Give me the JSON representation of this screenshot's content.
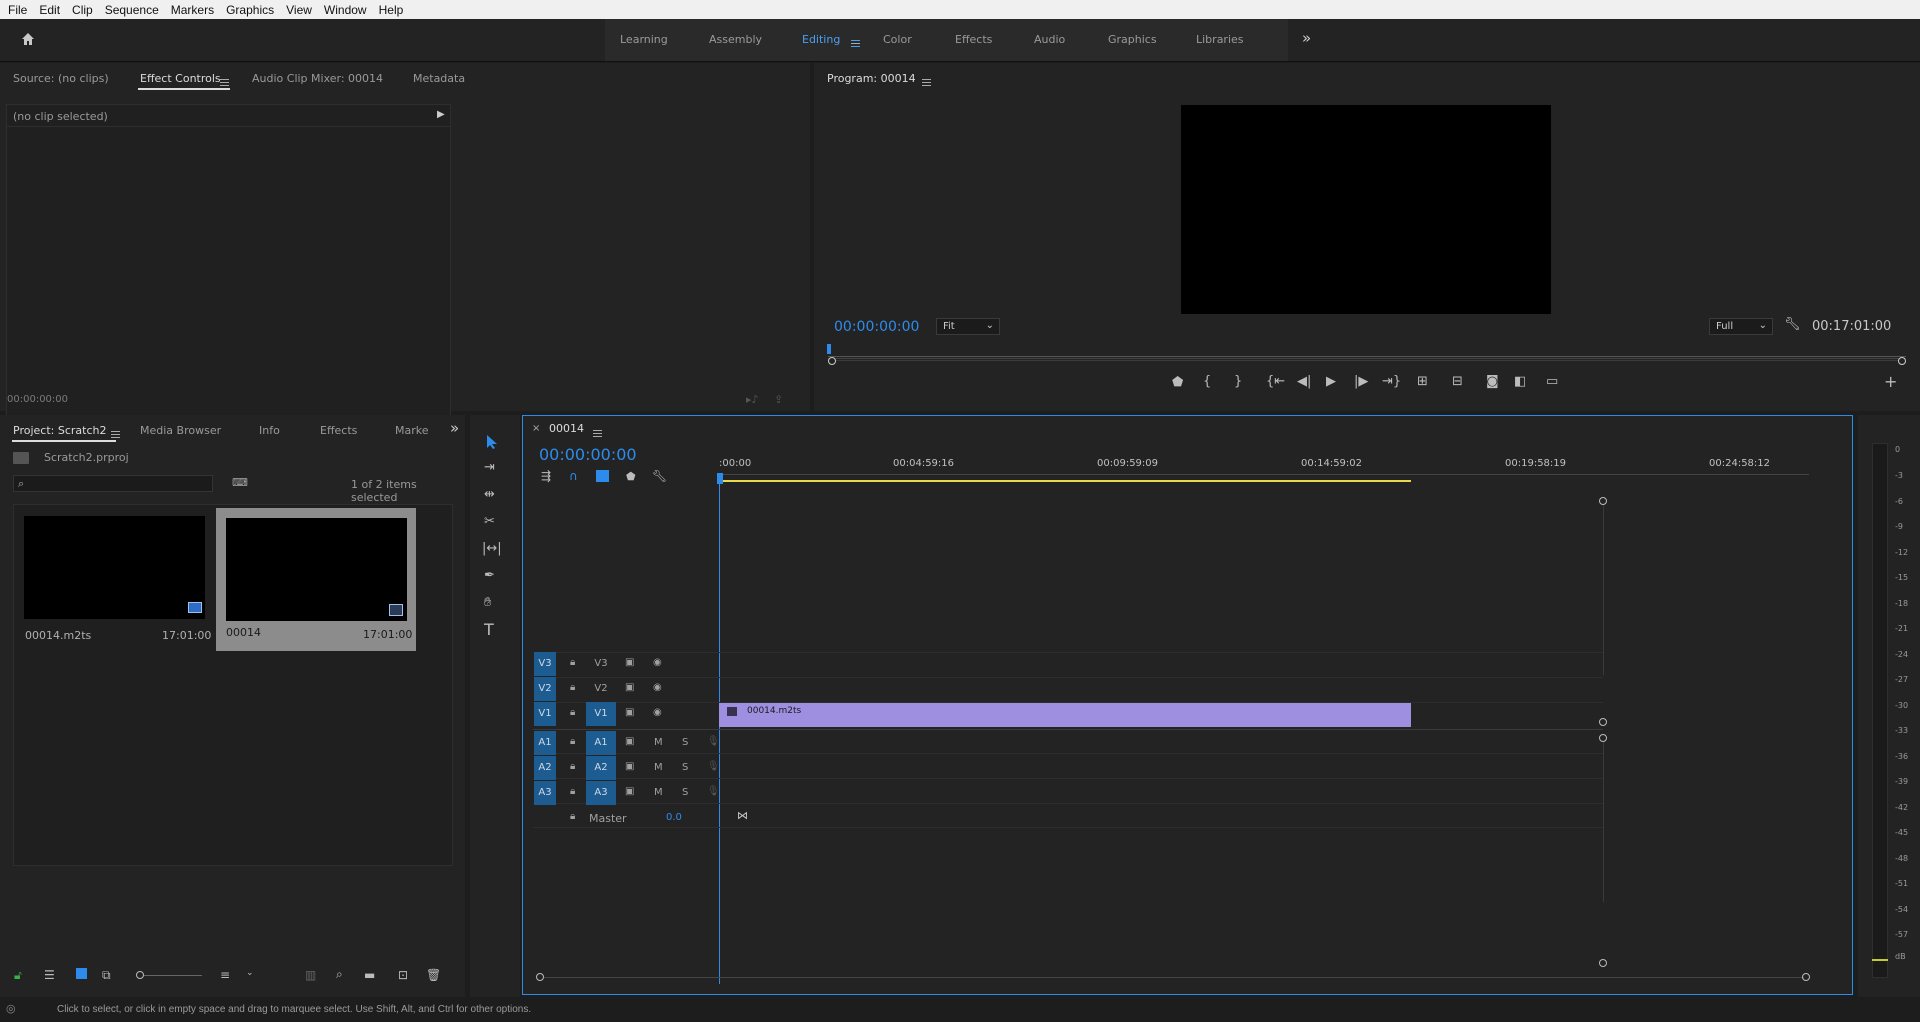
{
  "menu": [
    "File",
    "Edit",
    "Clip",
    "Sequence",
    "Markers",
    "Graphics",
    "View",
    "Window",
    "Help"
  ],
  "workspaces": {
    "tabs": [
      "Learning",
      "Assembly",
      "Editing",
      "Color",
      "Effects",
      "Audio",
      "Graphics",
      "Libraries"
    ],
    "active": "Editing",
    "more": "»"
  },
  "source_panel": {
    "tabs": [
      "Source: (no clips)",
      "Effect Controls",
      "Audio Clip Mixer: 00014",
      "Metadata"
    ],
    "active_tab": "Effect Controls",
    "no_clip": "(no clip selected)",
    "timecode": "00:00:00:00"
  },
  "program_panel": {
    "title": "Program: 00014",
    "timecode": "00:00:00:00",
    "fit": "Fit",
    "quality": "Full",
    "duration": "00:17:01:00"
  },
  "project_panel": {
    "tabs": [
      "Project: Scratch2",
      "Media Browser",
      "Info",
      "Effects",
      "Marke"
    ],
    "active_tab": "Project: Scratch2",
    "project_file": "Scratch2.prproj",
    "selection_info": "1 of 2 items selected",
    "search_placeholder": "",
    "items": [
      {
        "name": "00014.m2ts",
        "duration": "17:01:00",
        "selected": false
      },
      {
        "name": "00014",
        "duration": "17:01:00",
        "selected": true
      }
    ]
  },
  "timeline": {
    "sequence_name": "00014",
    "timecode": "00:00:00:00",
    "ruler": [
      ":00:00",
      "00:04:59:16",
      "00:09:59:09",
      "00:14:59:02",
      "00:19:58:19",
      "00:24:58:12"
    ],
    "video_tracks": [
      {
        "id": "V3",
        "target": "V3"
      },
      {
        "id": "V2",
        "target": "V2"
      },
      {
        "id": "V1",
        "target": "V1"
      }
    ],
    "audio_tracks": [
      {
        "id": "A1",
        "target": "A1",
        "m": "M",
        "s": "S"
      },
      {
        "id": "A2",
        "target": "A2",
        "m": "M",
        "s": "S"
      },
      {
        "id": "A3",
        "target": "A3",
        "m": "M",
        "s": "S"
      }
    ],
    "master": {
      "label": "Master",
      "value": "0.0"
    },
    "clip": {
      "name": "00014.m2ts",
      "color": "#9f8fe0"
    }
  },
  "meter_scale": [
    "0",
    "-3",
    "-6",
    "-9",
    "-12",
    "-15",
    "-18",
    "-21",
    "-24",
    "-27",
    "-30",
    "-33",
    "-36",
    "-39",
    "-42",
    "-45",
    "-48",
    "-51",
    "-54",
    "-57",
    "dB"
  ],
  "status_bar": "Click to select, or click in empty space and drag to marquee select. Use Shift, Alt, and Ctrl for other options.",
  "colors": {
    "accent": "#2d8ceb",
    "track_target": "#1c5c90",
    "clip": "#9f8fe0",
    "work_area": "#e8d84a"
  }
}
